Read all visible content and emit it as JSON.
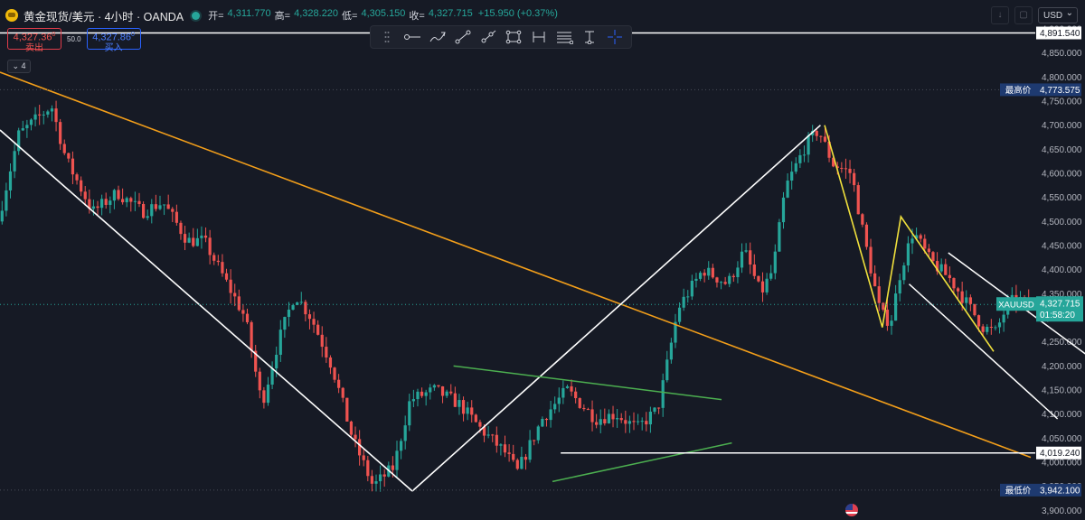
{
  "header": {
    "symbol_title": "黄金现货/美元 · 4小时 · OANDA",
    "open_label": "开=",
    "open_value": "4,311.770",
    "high_label": "高=",
    "high_value": "4,328.220",
    "low_label": "低=",
    "low_value": "4,305.150",
    "close_label": "收=",
    "close_value": "4,327.715",
    "change": "+15.950 (+0.37%)"
  },
  "trade": {
    "sell_price": "4,327.36",
    "sell_price_sup": "0",
    "sell_label": "卖出",
    "spread": "50.0",
    "buy_price": "4,327.86",
    "buy_price_sup": "0",
    "buy_label": "买入"
  },
  "indicator_collapse_count": "4",
  "currency_select": "USD",
  "toolbar": {
    "icons": [
      "drag-handle",
      "horizontal-ray",
      "brush",
      "trend-line",
      "ray",
      "rectangle",
      "horizontal-range",
      "fib-lines",
      "info-line",
      "crosshair"
    ]
  },
  "colors": {
    "background": "#161a25",
    "up": "#26a69a",
    "down": "#ef5350",
    "orange_trendline": "#f29e1a",
    "green_triangle": "#4caf50",
    "yellow_zigzag": "#f0e03c",
    "white_lines": "#ffffff"
  },
  "chart_data": {
    "type": "candlestick",
    "symbol": "XAUUSD",
    "timeframe": "4小时",
    "ylim": [
      3880,
      4960
    ],
    "y_ticks": [
      "3,900.000",
      "3,950.000",
      "4,000.000",
      "4,050.000",
      "4,100.000",
      "4,150.000",
      "4,200.000",
      "4,250.000",
      "4,300.000",
      "4,350.000",
      "4,400.000",
      "4,450.000",
      "4,500.000",
      "4,550.000",
      "4,600.000",
      "4,650.000",
      "4,700.000",
      "4,750.000",
      "4,800.000",
      "4,850.000",
      "4,900.000"
    ],
    "grid": false,
    "last_price": {
      "tag": "XAUUSD",
      "value": 4327.715,
      "label": "4,327.715",
      "countdown": "01:58:20"
    },
    "price_markers": [
      {
        "label": "",
        "value": 4891.54,
        "text": "4,891.540",
        "style": "white"
      },
      {
        "label": "最高价",
        "value": 4773.575,
        "text": "4,773.575",
        "style": "navy"
      },
      {
        "label": "",
        "value": 4019.24,
        "text": "4,019.240",
        "style": "white"
      },
      {
        "label": "最低价",
        "value": 3942.1,
        "text": "3,942.100",
        "style": "navy"
      }
    ],
    "candle_count": 248,
    "path_anchors": [
      [
        0,
        4500
      ],
      [
        10,
        4680
      ],
      [
        26,
        4740
      ],
      [
        33,
        4630
      ],
      [
        46,
        4520
      ],
      [
        58,
        4560
      ],
      [
        70,
        4520
      ],
      [
        80,
        4540
      ],
      [
        92,
        4460
      ],
      [
        100,
        4460
      ],
      [
        110,
        4380
      ],
      [
        120,
        4300
      ],
      [
        128,
        4120
      ],
      [
        136,
        4250
      ],
      [
        144,
        4350
      ],
      [
        152,
        4300
      ],
      [
        162,
        4200
      ],
      [
        172,
        4050
      ],
      [
        182,
        3950
      ],
      [
        192,
        3990
      ],
      [
        200,
        4130
      ],
      [
        212,
        4150
      ],
      [
        224,
        4120
      ],
      [
        234,
        4070
      ],
      [
        246,
        4020
      ],
      [
        252,
        3980
      ],
      [
        264,
        4090
      ],
      [
        276,
        4150
      ],
      [
        290,
        4090
      ],
      [
        300,
        4100
      ],
      [
        310,
        4070
      ],
      [
        320,
        4110
      ],
      [
        324,
        4190
      ],
      [
        330,
        4320
      ],
      [
        342,
        4400
      ],
      [
        354,
        4370
      ],
      [
        362,
        4440
      ],
      [
        370,
        4350
      ],
      [
        376,
        4400
      ],
      [
        382,
        4570
      ],
      [
        392,
        4660
      ],
      [
        398,
        4690
      ],
      [
        405,
        4620
      ],
      [
        414,
        4600
      ],
      [
        420,
        4470
      ],
      [
        428,
        4310
      ],
      [
        433,
        4290
      ],
      [
        438,
        4400
      ],
      [
        444,
        4480
      ],
      [
        452,
        4420
      ],
      [
        462,
        4380
      ],
      [
        470,
        4330
      ],
      [
        478,
        4280
      ],
      [
        484,
        4270
      ],
      [
        490,
        4330
      ],
      [
        495,
        4340
      ],
      [
        499,
        4328
      ]
    ],
    "drawings": {
      "orange_trendline": [
        [
          0,
          4810
        ],
        [
          500,
          4010
        ]
      ],
      "white_down_line": [
        [
          0,
          4690
        ],
        [
          200,
          3940
        ]
      ],
      "white_up_line": [
        [
          200,
          3940
        ],
        [
          398,
          4700
        ]
      ],
      "green_upper": [
        [
          220,
          4200
        ],
        [
          350,
          4130
        ]
      ],
      "green_lower": [
        [
          268,
          3960
        ],
        [
          355,
          4040
        ]
      ],
      "yellow_zigzag": [
        [
          400,
          4700
        ],
        [
          428,
          4280
        ],
        [
          437,
          4510
        ],
        [
          482,
          4230
        ]
      ],
      "white_channel_lower": [
        [
          441,
          4370
        ],
        [
          513,
          4090
        ]
      ],
      "white_channel_upper": [
        [
          460,
          4435
        ],
        [
          536,
          4195
        ]
      ],
      "horizontal_lines": [
        4891.54,
        4019.24
      ]
    }
  }
}
